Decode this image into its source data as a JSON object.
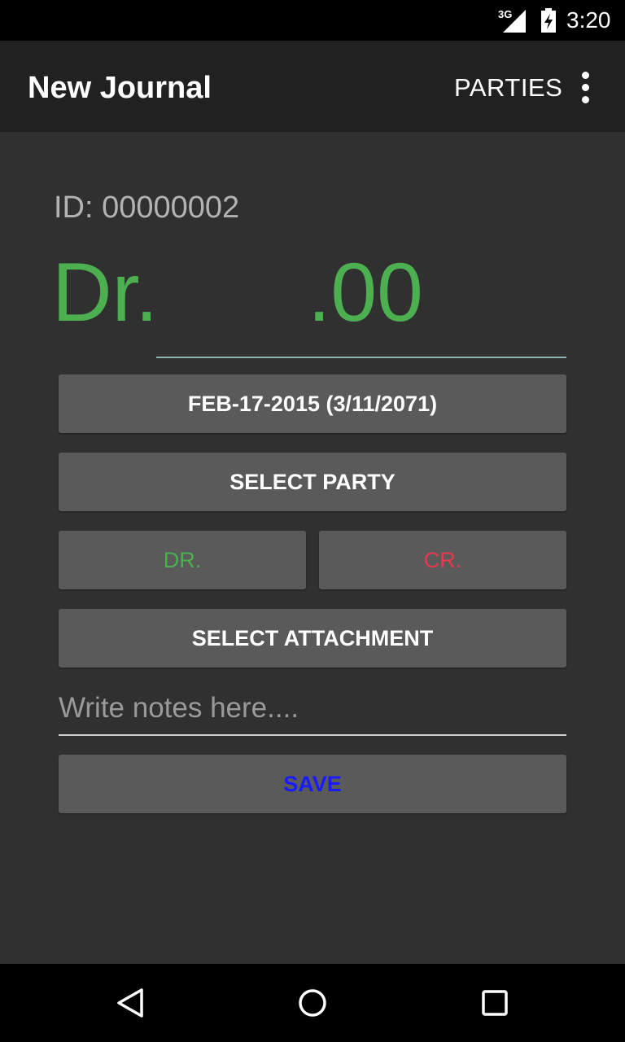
{
  "status_bar": {
    "network": "3G",
    "time": "3:20"
  },
  "app_bar": {
    "title": "New Journal",
    "parties_action": "PARTIES"
  },
  "form": {
    "id_label": "ID: 00000002",
    "amount_prefix": "Dr.",
    "amount_value": ".00",
    "date_button": "FEB-17-2015 (3/11/2071)",
    "select_party_button": "SELECT PARTY",
    "dr_button": "DR.",
    "cr_button": "CR.",
    "select_attachment_button": "SELECT ATTACHMENT",
    "notes_placeholder": "Write notes here....",
    "notes_value": "",
    "save_button": "SAVE"
  },
  "colors": {
    "debit_green": "#4caf50",
    "credit_red": "#e53950",
    "save_blue": "#1a1aff"
  }
}
